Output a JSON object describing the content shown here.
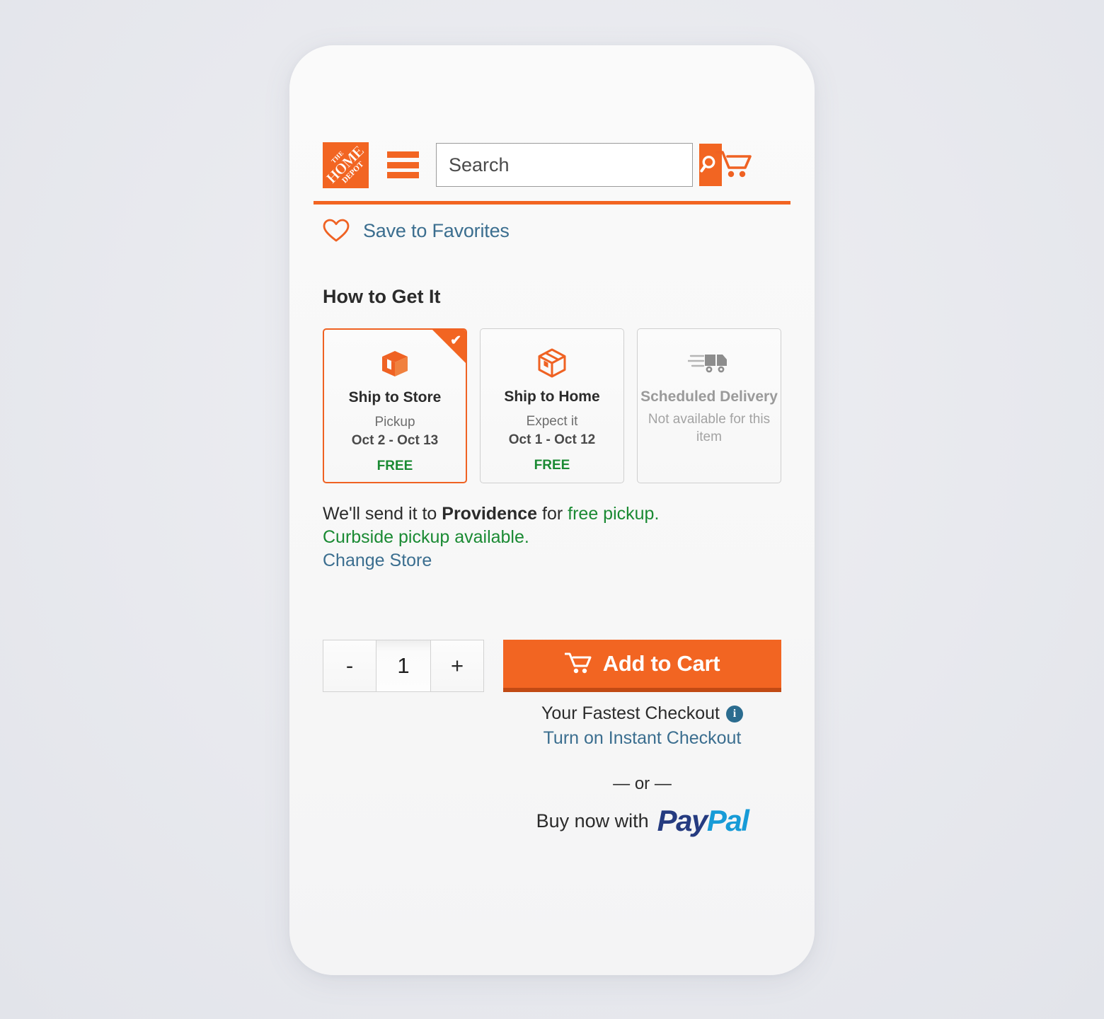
{
  "header": {
    "logo_lines": {
      "the": "THE",
      "home": "HOME",
      "depot": "DEPOT"
    },
    "logo_name": "The Home Depot",
    "menu_name": "menu",
    "search": {
      "placeholder": "Search",
      "value": "",
      "button_name": "search"
    },
    "cart_name": "cart"
  },
  "favorites": {
    "label": "Save to Favorites"
  },
  "how_to_get_it": {
    "title": "How to Get It",
    "options": [
      {
        "title": "Ship to Store",
        "sub": "Pickup",
        "dates": "Oct 2 - Oct 13",
        "price": "FREE",
        "selected": true,
        "check": "✔",
        "icon": "open-box-icon"
      },
      {
        "title": "Ship to Home",
        "sub": "Expect it",
        "dates": "Oct 1 - Oct 12",
        "price": "FREE",
        "selected": false,
        "icon": "closed-box-icon"
      },
      {
        "title": "Scheduled Delivery",
        "note": "Not available for this item",
        "selected": false,
        "disabled": true,
        "icon": "delivery-truck-icon"
      }
    ]
  },
  "store_info": {
    "line1_prefix": "We'll send it to",
    "store_name": "Providence",
    "line1_mid": "for",
    "line1_green": "free pickup.",
    "curbside": "Curbside pickup available.",
    "change_store": "Change Store"
  },
  "purchase": {
    "qty_decrement": "-",
    "qty_value": "1",
    "qty_increment": "+",
    "add_to_cart": "Add to Cart",
    "fastest_checkout": "Your Fastest Checkout",
    "info_glyph": "i",
    "instant_checkout_link": "Turn on Instant Checkout",
    "or_divider": "— or —",
    "paypal_prefix": "Buy now with",
    "paypal_pay": "Pay",
    "paypal_pal": "Pal"
  },
  "colors": {
    "brand_orange": "#f26522",
    "link_blue": "#3b6e8f",
    "free_green": "#1a8a33",
    "paypal_dark": "#253b80",
    "paypal_light": "#179bd7"
  }
}
